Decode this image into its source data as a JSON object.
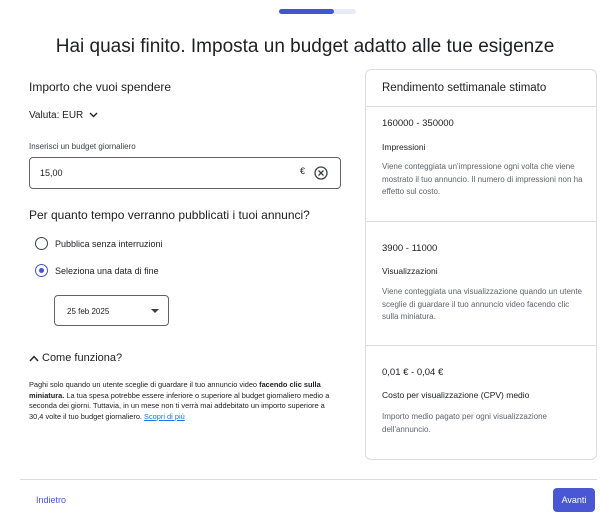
{
  "progress": {
    "fraction": 0.72
  },
  "header": {
    "title": "Hai quasi finito. Imposta un budget adatto alle tue esigenze"
  },
  "budget": {
    "section_title": "Importo che vuoi spendere",
    "currency_label": "Valuta: EUR",
    "field_label": "Inserisci un budget giornaliero",
    "value": "15,00",
    "currency_symbol": "€"
  },
  "duration": {
    "question": "Per quanto tempo verranno pubblicati i tuoi annunci?",
    "options": [
      {
        "label": "Pubblica senza interruzioni",
        "selected": false
      },
      {
        "label": "Seleziona una data di fine",
        "selected": true
      }
    ],
    "end_date": "25 feb 2025"
  },
  "how_it_works": {
    "toggle_label": "Come funziona?",
    "text_1": "Paghi solo quando un utente sceglie di guardare il tuo annuncio video ",
    "text_bold": "facendo clic sulla miniatura.",
    "text_2": " La tua spesa potrebbe essere inferiore o superiore al budget giornaliero medio a seconda dei giorni. Tuttavia, in un mese non ti verrà mai addebitato un importo superiore a 30,4 volte il tuo budget giornaliero. ",
    "link": "Scopri di più"
  },
  "estimate": {
    "title": "Rendimento settimanale stimato",
    "metrics": [
      {
        "range": "160000 - 350000",
        "name": "Impressioni",
        "description": "Viene conteggiata un'impressione ogni volta che viene mostrato il tuo annuncio. Il numero di impressioni non ha effetto sul costo."
      },
      {
        "range": "3900 - 11000",
        "name": "Visualizzazioni",
        "description": "Viene conteggiata una visualizzazione quando un utente sceglie di guardare il tuo annuncio video facendo clic sulla miniatura."
      },
      {
        "range": "0,01 € - 0,04 €",
        "name": "Costo per visualizzazione (CPV) medio",
        "description": "Importo medio pagato per ogni visualizzazione dell'annuncio."
      }
    ]
  },
  "footer": {
    "back_label": "Indietro",
    "next_label": "Avanti"
  },
  "colors": {
    "accent": "#4255d4",
    "border": "#dadce0",
    "muted_text": "#5f6368"
  }
}
